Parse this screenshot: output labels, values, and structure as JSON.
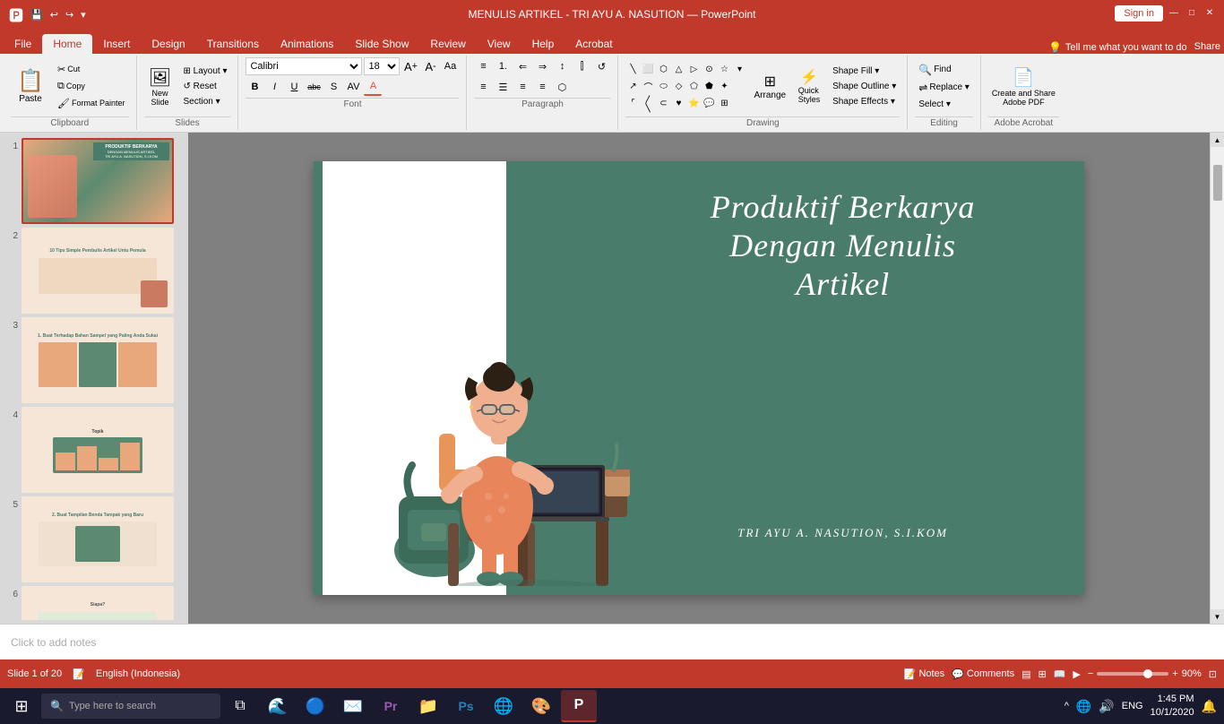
{
  "titleBar": {
    "title": "MENULIS ARTIKEL - TRI AYU A. NASUTION — PowerPoint",
    "saveIcon": "💾",
    "undoIcon": "↩",
    "redoIcon": "↪",
    "customizeIcon": "▾",
    "signInLabel": "Sign in",
    "minimizeIcon": "—",
    "maximizeIcon": "□",
    "closeIcon": "✕"
  },
  "ribbonTabs": {
    "tabs": [
      "File",
      "Home",
      "Insert",
      "Design",
      "Transitions",
      "Animations",
      "Slide Show",
      "Review",
      "View",
      "Help",
      "Acrobat"
    ],
    "activeTab": "Home",
    "tellMePlaceholder": "Tell me what you want to do",
    "shareLabel": "Share"
  },
  "ribbon": {
    "clipboard": {
      "label": "Clipboard",
      "paste": "Paste",
      "cut": "✂",
      "copy": "⧉",
      "formatPainter": "🖌"
    },
    "slides": {
      "label": "Slides",
      "newSlide": "New\nSlide",
      "layout": "Layout ▾",
      "reset": "Reset",
      "section": "Section ▾"
    },
    "font": {
      "label": "Font",
      "fontFamily": "Calibri",
      "fontSize": "18",
      "growFont": "A↑",
      "shrinkFont": "A↓",
      "clearFormat": "Aa",
      "bold": "B",
      "italic": "I",
      "underline": "U",
      "strikethrough": "abc",
      "shadow": "S",
      "fontColor": "A",
      "charSpacing": "AV"
    },
    "paragraph": {
      "label": "Paragraph",
      "bullets": "☰",
      "numbering": "1.",
      "decreaseIndent": "←",
      "increaseIndent": "→",
      "lineSpacing": "≡",
      "columns": "⫿",
      "alignLeft": "≡",
      "alignCenter": "☰",
      "alignRight": "≡",
      "justify": "≡",
      "textDirection": "↕"
    },
    "drawing": {
      "label": "Drawing",
      "arrange": "Arrange",
      "quickStyles": "Quick\nStyles",
      "shapeFill": "Shape Fill ▾",
      "shapeOutline": "Shape Outline ▾",
      "shapeEffects": "Shape Effects ▾"
    },
    "editing": {
      "label": "Editing",
      "find": "Find",
      "replace": "Replace ▾",
      "select": "Select ▾"
    },
    "adobeAcrobat": {
      "label": "Adobe Acrobat",
      "createAndShare": "Create and Share\nAdobe PDF"
    }
  },
  "slides": [
    {
      "num": "1",
      "active": true
    },
    {
      "num": "2",
      "active": false
    },
    {
      "num": "3",
      "active": false
    },
    {
      "num": "4",
      "active": false
    },
    {
      "num": "5",
      "active": false
    },
    {
      "num": "6",
      "active": false
    }
  ],
  "mainSlide": {
    "titleLine1": "Produktif Berkarya",
    "titleLine2": "dengan Menulis",
    "titleLine3": "Artikel",
    "subtitle": "Tri Ayu A. Nasution, S.I.Kom"
  },
  "notesBar": {
    "placeholder": "Click to add notes",
    "notesLabel": "Notes",
    "commentsLabel": "Comments"
  },
  "statusBar": {
    "slideInfo": "Slide 1 of 20",
    "language": "English (Indonesia)",
    "notesIcon": "Notes",
    "commentsIcon": "Comments",
    "viewNormal": "▤",
    "viewSlide": "⊞",
    "viewReading": "📖",
    "viewPresenter": "▶",
    "zoomOut": "−",
    "zoomIn": "+",
    "zoomLevel": "90%"
  },
  "taskbar": {
    "startIcon": "⊞",
    "searchPlaceholder": "Type here to search",
    "taskView": "⧉",
    "edgeIcon": "e",
    "chromeIcon": "●",
    "mailIcon": "✉",
    "photoshopIcon": "Ps",
    "folderIcon": "📁",
    "photoshop2Icon": "Ps",
    "browserIcon": "🌐",
    "paintIcon": "🎨",
    "powerpointIcon": "P",
    "systemTray": {
      "upArrow": "^",
      "network": "🌐",
      "volume": "🔊",
      "lang": "ENG",
      "time": "1:45 PM",
      "date": "10/1/2020",
      "notification": "🔔"
    }
  }
}
